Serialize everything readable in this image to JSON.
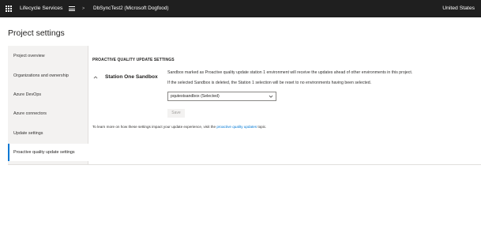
{
  "header": {
    "app_title": "Lifecycle Services",
    "breadcrumb_separator": ">",
    "project_name": "DbSyncTest2 (Microsoft Dogfood)",
    "region": "United States",
    "icons": [
      "waffle-icon",
      "hamburger-menu-icon"
    ]
  },
  "page": {
    "title": "Project settings"
  },
  "sidebar": {
    "items": [
      {
        "label": "Project overview",
        "selected": false
      },
      {
        "label": "Organizations and ownership",
        "selected": false
      },
      {
        "label": "Azure DevOps",
        "selected": false
      },
      {
        "label": "Azure connectors",
        "selected": false
      },
      {
        "label": "Update settings",
        "selected": false
      },
      {
        "label": "Proactive quality update settings",
        "selected": true
      }
    ]
  },
  "main": {
    "section_header": "PROACTIVE QUALITY UPDATE SETTINGS",
    "sandbox_title": "Station One Sandbox",
    "description_1": "Sandbox marked as Proactive quality update station 1 environment will receive the updates ahead of other environments in this project.",
    "description_2": "If the selected Sandbox is deleted, the Station 1 selection will be reset to no environments having been selected.",
    "dropdown_value": "pqutestsandbox (Selected)",
    "save_label": "Save",
    "learn_more_prefix": "To learn more on how these settings impact your update experience, visit the",
    "learn_more_link": "proactive quality updates",
    "learn_more_suffix": "topic."
  },
  "colors": {
    "topbar": "#1f1f1f",
    "accent": "#0078d4",
    "sidebar_bg": "#f3f2f1"
  }
}
